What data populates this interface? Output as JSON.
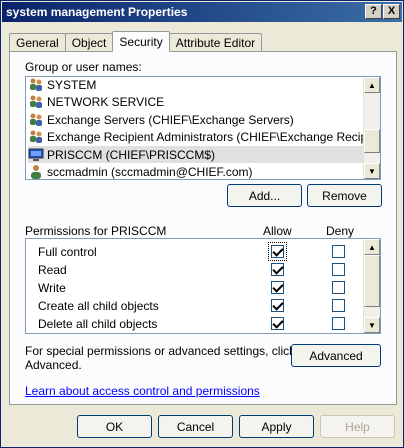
{
  "window": {
    "title": "system management Properties",
    "help_glyph": "?",
    "close_glyph": "X"
  },
  "tabs": [
    {
      "label": "General",
      "active": false
    },
    {
      "label": "Object",
      "active": false
    },
    {
      "label": "Security",
      "active": true
    },
    {
      "label": "Attribute Editor",
      "active": false
    }
  ],
  "security": {
    "group_label": "Group or user names:",
    "users": [
      {
        "name": "SYSTEM",
        "icon": "group-icon",
        "selected": false
      },
      {
        "name": "NETWORK SERVICE",
        "icon": "group-icon",
        "selected": false
      },
      {
        "name": "Exchange Servers (CHIEF\\Exchange Servers)",
        "icon": "group-icon",
        "selected": false
      },
      {
        "name": "Exchange Recipient Administrators (CHIEF\\Exchange Recipient ...",
        "icon": "group-icon",
        "selected": false
      },
      {
        "name": "PRISCCM (CHIEF\\PRISCCM$)",
        "icon": "computer-icon",
        "selected": true
      },
      {
        "name": "sccmadmin (sccmadmin@CHIEF.com)",
        "icon": "user-icon",
        "selected": false
      }
    ],
    "add_label": "Add...",
    "remove_label": "Remove",
    "permissions_label": "Permissions for PRISCCM",
    "allow_header": "Allow",
    "deny_header": "Deny",
    "permissions": [
      {
        "name": "Full control",
        "allow": true,
        "deny": false
      },
      {
        "name": "Read",
        "allow": true,
        "deny": false
      },
      {
        "name": "Write",
        "allow": true,
        "deny": false
      },
      {
        "name": "Create all child objects",
        "allow": true,
        "deny": false
      },
      {
        "name": "Delete all child objects",
        "allow": true,
        "deny": false
      }
    ],
    "special_text_line1": "For special permissions or advanced settings, click",
    "special_text_line2": "Advanced.",
    "advanced_label": "Advanced",
    "learn_link": "Learn about access control and permissions"
  },
  "footer": {
    "ok_label": "OK",
    "cancel_label": "Cancel",
    "apply_label": "Apply",
    "help_label": "Help"
  }
}
